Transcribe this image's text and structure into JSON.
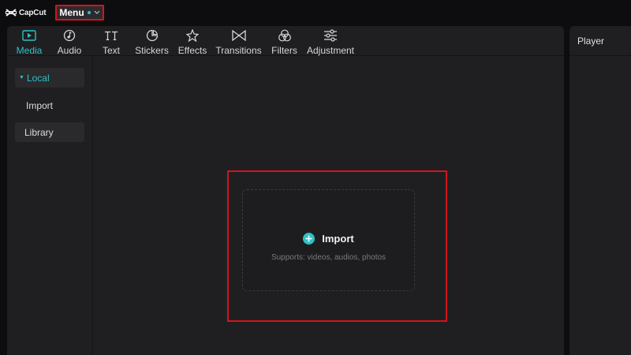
{
  "app": {
    "logo_text": "CapCut",
    "menu_label": "Menu"
  },
  "toolbar": {
    "items": [
      {
        "label": "Media",
        "icon": "media-icon"
      },
      {
        "label": "Audio",
        "icon": "audio-icon"
      },
      {
        "label": "Text",
        "icon": "text-icon"
      },
      {
        "label": "Stickers",
        "icon": "stickers-icon"
      },
      {
        "label": "Effects",
        "icon": "effects-icon"
      },
      {
        "label": "Transitions",
        "icon": "transitions-icon"
      },
      {
        "label": "Filters",
        "icon": "filters-icon"
      },
      {
        "label": "Adjustment",
        "icon": "adjustment-icon"
      }
    ],
    "active": "Media"
  },
  "sidebar": {
    "items": [
      {
        "label": "Local"
      },
      {
        "label": "Import"
      },
      {
        "label": "Library"
      }
    ]
  },
  "dropzone": {
    "title": "Import",
    "subtitle": "Supports: videos, audios, photos"
  },
  "player": {
    "title": "Player"
  },
  "colors": {
    "accent": "#2ec2c9",
    "highlight": "#d4141c",
    "background": "#0d0d0f",
    "panel": "#1f1f21"
  }
}
